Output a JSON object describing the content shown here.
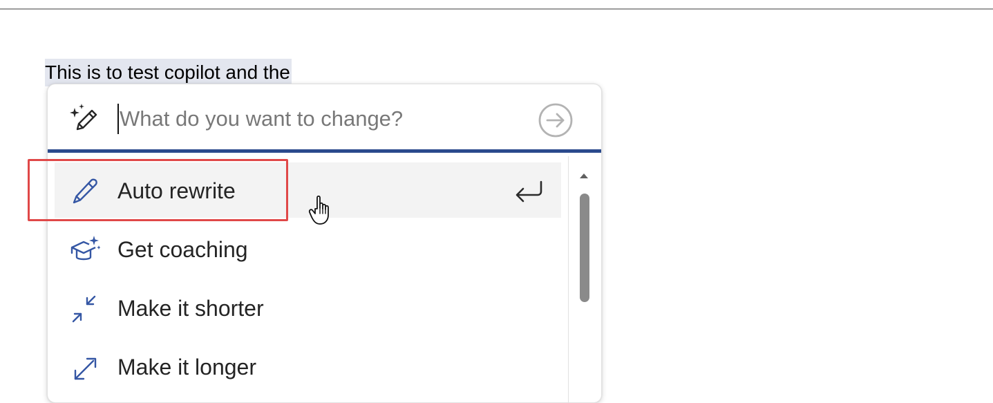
{
  "document": {
    "selected_text": "This is to test copilot and the"
  },
  "copilot_popup": {
    "prompt": {
      "icon": "sparkle-pen-icon",
      "placeholder": "What do you want to change?",
      "value": "",
      "send_icon": "arrow-right-circle-icon"
    },
    "menu": {
      "items": [
        {
          "label": "Auto rewrite",
          "icon": "pen-icon",
          "state": "hovered",
          "shortcut_icon": "enter-key-icon"
        },
        {
          "label": "Get coaching",
          "icon": "graduation-cap-sparkle-icon"
        },
        {
          "label": "Make it shorter",
          "icon": "arrows-collapse-icon"
        },
        {
          "label": "Make it longer",
          "icon": "arrows-expand-icon"
        }
      ]
    },
    "scrollbar": {
      "up_icon": "triangle-up-icon"
    }
  },
  "annotation": {
    "highlight_color": "#e04848",
    "highlight_target": "Auto rewrite"
  },
  "colors": {
    "accent": "#2b4a8d",
    "icon_blue": "#3456a4",
    "selection": "#e3e6ef",
    "hover_row": "#f3f3f3"
  }
}
